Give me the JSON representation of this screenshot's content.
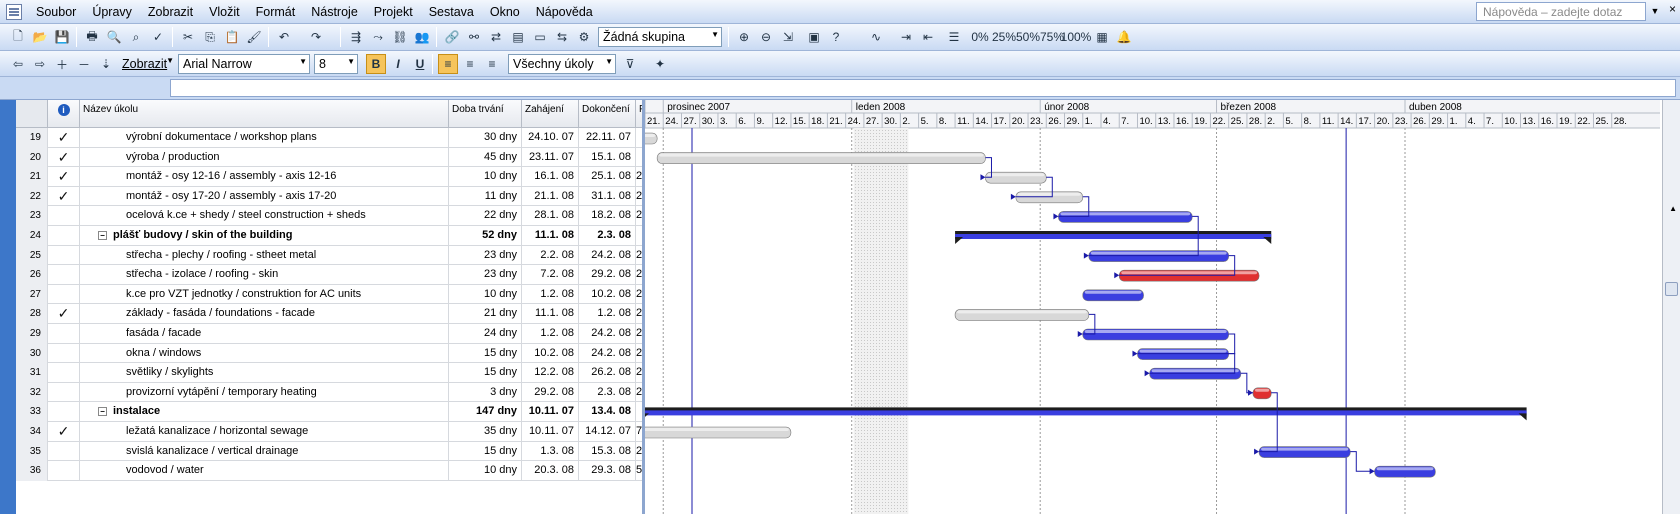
{
  "menubar": {
    "items": [
      "Soubor",
      "Úpravy",
      "Zobrazit",
      "Vložit",
      "Formát",
      "Nástroje",
      "Projekt",
      "Sestava",
      "Okno",
      "Nápověda"
    ],
    "help_placeholder": "Nápověda – zadejte dotaz"
  },
  "toolbar1": {
    "group_value": "Žádná skupina"
  },
  "toolbar2": {
    "show_label": "Zobrazit",
    "font_value": "Arial Narrow",
    "size_value": "8",
    "filter_value": "Všechny úkoly",
    "bold_label": "B",
    "italic_label": "I",
    "underline_label": "U"
  },
  "table": {
    "headers": {
      "id": "",
      "indicators": "i",
      "name": "Název úkolu",
      "duration": "Doba trvání",
      "start": "Zahájení",
      "finish": "Dokončení",
      "pred": "P"
    },
    "rows": [
      {
        "id": "19",
        "done": true,
        "name": "výrobní dokumentace / workshop plans",
        "duration": "30 dny",
        "start": "24.10. 07",
        "finish": "22.11. 07",
        "pred": "",
        "summary": false
      },
      {
        "id": "20",
        "done": true,
        "name": "výroba / production",
        "duration": "45 dny",
        "start": "23.11. 07",
        "finish": "15.1. 08",
        "pred": "",
        "summary": false
      },
      {
        "id": "21",
        "done": true,
        "name": "montáž - osy 12-16 / assembly - axis 12-16",
        "duration": "10 dny",
        "start": "16.1. 08",
        "finish": "25.1. 08",
        "pred": "2",
        "summary": false
      },
      {
        "id": "22",
        "done": true,
        "name": "montáž - osy 17-20 / assembly - axis 17-20",
        "duration": "11 dny",
        "start": "21.1. 08",
        "finish": "31.1. 08",
        "pred": "2",
        "summary": false
      },
      {
        "id": "23",
        "done": false,
        "name": "ocelová k.ce + shedy / steel construction + sheds",
        "duration": "22 dny",
        "start": "28.1. 08",
        "finish": "18.2. 08",
        "pred": "2",
        "summary": false
      },
      {
        "id": "24",
        "done": false,
        "name": "plášť budovy / skin of the building",
        "duration": "52 dny",
        "start": "11.1. 08",
        "finish": "2.3. 08",
        "pred": "",
        "summary": true
      },
      {
        "id": "25",
        "done": false,
        "name": "střecha - plechy / roofing - stheet metal",
        "duration": "23 dny",
        "start": "2.2. 08",
        "finish": "24.2. 08",
        "pred": "2",
        "summary": false
      },
      {
        "id": "26",
        "done": false,
        "name": "střecha - izolace / roofing - skin",
        "duration": "23 dny",
        "start": "7.2. 08",
        "finish": "29.2. 08",
        "pred": "2",
        "summary": false
      },
      {
        "id": "27",
        "done": false,
        "name": "k.ce pro VZT jednotky / construktion for AC units",
        "duration": "10 dny",
        "start": "1.2. 08",
        "finish": "10.2. 08",
        "pred": "2",
        "summary": false
      },
      {
        "id": "28",
        "done": true,
        "name": "základy - fasáda / foundations - facade",
        "duration": "21 dny",
        "start": "11.1. 08",
        "finish": "1.2. 08",
        "pred": "2",
        "summary": false
      },
      {
        "id": "29",
        "done": false,
        "name": "fasáda / facade",
        "duration": "24 dny",
        "start": "1.2. 08",
        "finish": "24.2. 08",
        "pred": "2",
        "summary": false
      },
      {
        "id": "30",
        "done": false,
        "name": "okna / windows",
        "duration": "15 dny",
        "start": "10.2. 08",
        "finish": "24.2. 08",
        "pred": "2",
        "summary": false
      },
      {
        "id": "31",
        "done": false,
        "name": "světliky / skylights",
        "duration": "15 dny",
        "start": "12.2. 08",
        "finish": "26.2. 08",
        "pred": "2",
        "summary": false
      },
      {
        "id": "32",
        "done": false,
        "name": "provizorní vytápění / temporary heating",
        "duration": "3 dny",
        "start": "29.2. 08",
        "finish": "2.3. 08",
        "pred": "2",
        "summary": false
      },
      {
        "id": "33",
        "done": false,
        "name": "instalace",
        "duration": "147 dny",
        "start": "10.11. 07",
        "finish": "13.4. 08",
        "pred": "",
        "summary": true
      },
      {
        "id": "34",
        "done": true,
        "name": "ležatá kanalizace / horizontal sewage",
        "duration": "35 dny",
        "start": "10.11. 07",
        "finish": "14.12. 07",
        "pred": "7",
        "summary": false
      },
      {
        "id": "35",
        "done": false,
        "name": "svislá kanalizace / vertical drainage",
        "duration": "15 dny",
        "start": "1.3. 08",
        "finish": "15.3. 08",
        "pred": "2",
        "summary": false
      },
      {
        "id": "36",
        "done": false,
        "name": "vodovod / water",
        "duration": "10 dny",
        "start": "20.3. 08",
        "finish": "29.3. 08",
        "pred": "5",
        "summary": false
      }
    ]
  },
  "timescale": {
    "months": [
      {
        "label": "",
        "days": 3
      },
      {
        "label": "prosinec 2007",
        "days": 31
      },
      {
        "label": "leden 2008",
        "days": 31
      },
      {
        "label": "únor 2008",
        "days": 29
      },
      {
        "label": "březen 2008",
        "days": 31
      },
      {
        "label": "duben 2008",
        "days": 31
      }
    ],
    "ticks": [
      "21.",
      "24.",
      "27.",
      "30.",
      "3.",
      "6.",
      "9.",
      "12.",
      "15.",
      "18.",
      "21.",
      "24.",
      "27.",
      "30.",
      "2.",
      "5.",
      "8.",
      "11.",
      "14.",
      "17.",
      "20.",
      "23.",
      "26.",
      "29.",
      "1.",
      "4.",
      "7.",
      "10.",
      "13.",
      "16.",
      "19.",
      "22.",
      "25.",
      "28.",
      "2.",
      "5.",
      "8.",
      "11.",
      "14.",
      "17.",
      "20.",
      "23.",
      "26.",
      "29.",
      "1.",
      "4.",
      "7.",
      "10.",
      "13.",
      "16.",
      "19.",
      "22.",
      "25.",
      "28."
    ]
  },
  "colors": {
    "normal": "#3a3ee0",
    "critical": "#e03030",
    "completed": "#d8d8d8",
    "summary": "#1d1d1d",
    "link": "#1a1aa8"
  }
}
